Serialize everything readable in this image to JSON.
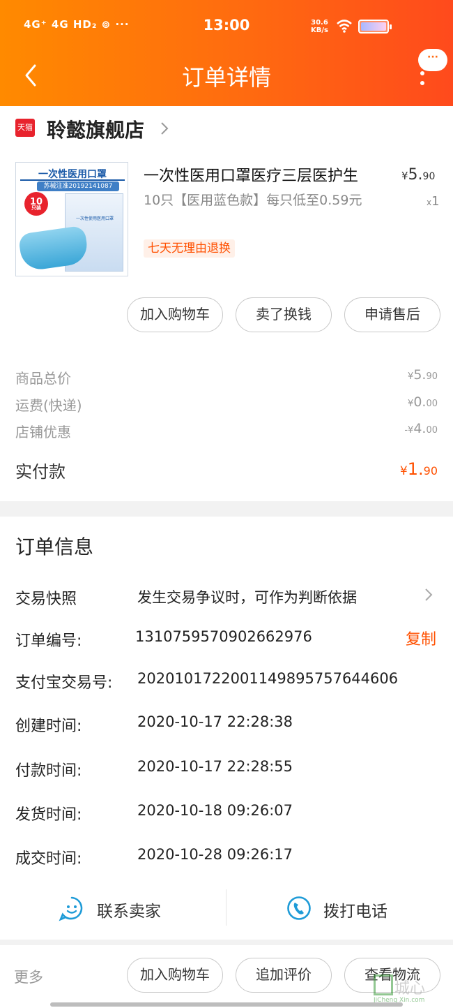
{
  "status_bar": {
    "network": "4G⁺ 4G HD₂ ⊚ ···",
    "time": "13:00",
    "speed_value": "30.6",
    "speed_unit": "KB/s"
  },
  "nav": {
    "title": "订单详情",
    "more_label": "···"
  },
  "store": {
    "badge": "天猫",
    "name": "聆懿旗舰店"
  },
  "product": {
    "image_text": {
      "banner": "一次性医用口罩",
      "reg": "苏械注准20192141087",
      "count": "10",
      "count_unit": "只装",
      "pack_text": "一次性使用医用口罩"
    },
    "title": "一次性医用口罩医疗三层医护生",
    "sku": "10只【医用蓝色款】每只低至0.59元",
    "price_symbol": "¥",
    "price_int": "5.",
    "price_dec": "90",
    "qty_prefix": "x",
    "qty": "1",
    "return_tag": "七天无理由退换"
  },
  "product_actions": {
    "add_cart": "加入购物车",
    "resell": "卖了换钱",
    "after_sale": "申请售后"
  },
  "summary": {
    "rows": [
      {
        "label": "商品总价",
        "prefix": "¥",
        "int": "5.",
        "dec": "90"
      },
      {
        "label": "运费(快递)",
        "prefix": "¥",
        "int": "0.",
        "dec": "00"
      },
      {
        "label": "店铺优惠",
        "prefix": "-¥",
        "int": "4.",
        "dec": "00"
      }
    ],
    "paid_label": "实付款",
    "paid_symbol": "¥",
    "paid_int": "1.",
    "paid_dec": "90"
  },
  "order_info": {
    "title": "订单信息",
    "snapshot_label": "交易快照",
    "snapshot_value": "发生交易争议时，可作为判断依据",
    "order_no_label": "订单编号:",
    "order_no": "1310759570902662976",
    "copy_label": "复制",
    "alipay_label": "支付宝交易号:",
    "alipay_no": "2020101722001149895757644606",
    "created_label": "创建时间:",
    "created": "2020-10-17 22:28:38",
    "paid_label": "付款时间:",
    "paid": "2020-10-17 22:28:55",
    "shipped_label": "发货时间:",
    "shipped": "2020-10-18 09:26:07",
    "completed_label": "成交时间:",
    "completed": "2020-10-28 09:26:17"
  },
  "contact": {
    "seller": "联系卖家",
    "phone": "拨打电话"
  },
  "bottom_bar": {
    "more": "更多",
    "add_cart": "加入购物车",
    "add_review": "追加评价",
    "logistics": "查看物流"
  },
  "watermark": {
    "text": "城心",
    "url": "JiCheng Xin.com"
  },
  "colors": {
    "accent": "#ff5000",
    "header_start": "#ff8a00",
    "header_end": "#ff4a1c",
    "contact_icon": "#1e9bd7"
  }
}
